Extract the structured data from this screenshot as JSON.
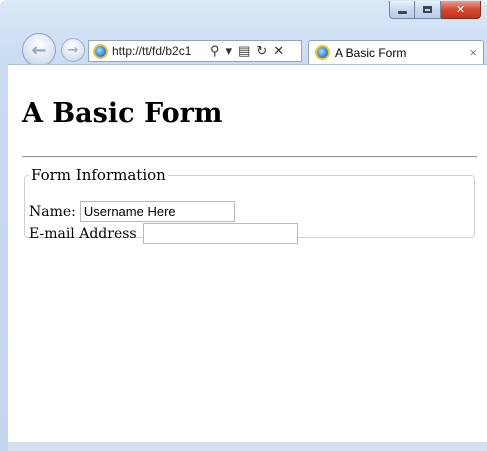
{
  "window": {
    "caption_buttons": {
      "minimize": "minimize-icon",
      "maximize": "maximize-icon",
      "close": "close-icon"
    }
  },
  "toolbar": {
    "back_icon": "←",
    "forward_icon": "→",
    "address": "http://tt/fd/b2c1",
    "search_icon": "⚲",
    "dropdown_icon": "▾",
    "compat_icon": "▤",
    "refresh_icon": "↻",
    "stop_icon": "✕"
  },
  "tab": {
    "title": "A Basic Form",
    "close_icon": "×"
  },
  "page": {
    "heading": "A Basic Form",
    "legend": "Form Information",
    "name_label": "Name:",
    "name_value": "Username Here",
    "email_label": "E-mail Address",
    "email_value": ""
  },
  "colors": {
    "frame": "#c9dcf2",
    "close_button": "#d4482f"
  }
}
